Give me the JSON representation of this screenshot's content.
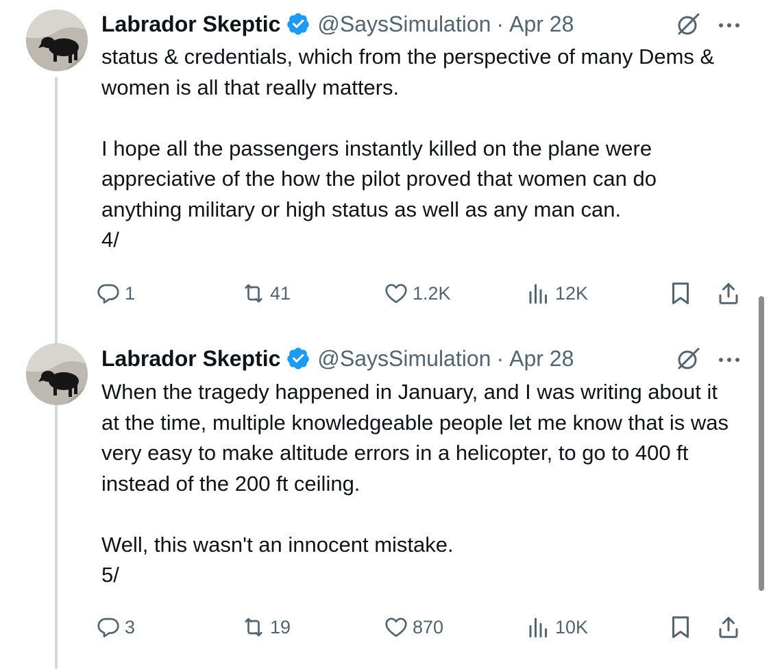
{
  "tweets": [
    {
      "author": {
        "name": "Labrador Skeptic",
        "handle": "@SaysSimulation",
        "date": "Apr 28"
      },
      "separator": "·",
      "text": "status & credentials, which from the perspective of many Dems & women is all that really matters.\n\nI hope all the passengers instantly killed on the plane were appreciative of the how the pilot proved that women can do anything military or high status as well as any man can.\n4/",
      "stats": {
        "replies": "1",
        "reposts": "41",
        "likes": "1.2K",
        "views": "12K"
      }
    },
    {
      "author": {
        "name": "Labrador Skeptic",
        "handle": "@SaysSimulation",
        "date": "Apr 28"
      },
      "separator": "·",
      "text": "When the tragedy happened in January, and I was writing about it at the time, multiple knowledgeable people let me know that is was very easy to make altitude errors in a helicopter, to go to 400 ft instead of the 200 ft ceiling.\n\nWell, this wasn't an innocent mistake.\n5/",
      "stats": {
        "replies": "3",
        "reposts": "19",
        "likes": "870",
        "views": "10K"
      }
    }
  ],
  "icons": {
    "verified": "verified-badge-icon",
    "grok": "grok-icon",
    "more": "more-dots-icon",
    "reply": "reply-icon",
    "repost": "repost-icon",
    "like": "heart-icon",
    "views": "views-chart-icon",
    "bookmark": "bookmark-icon",
    "share": "share-icon"
  },
  "colors": {
    "verified": "#1d9bf0",
    "muted": "#536471",
    "thread_line": "#cfd9de",
    "text": "#0f1419"
  }
}
